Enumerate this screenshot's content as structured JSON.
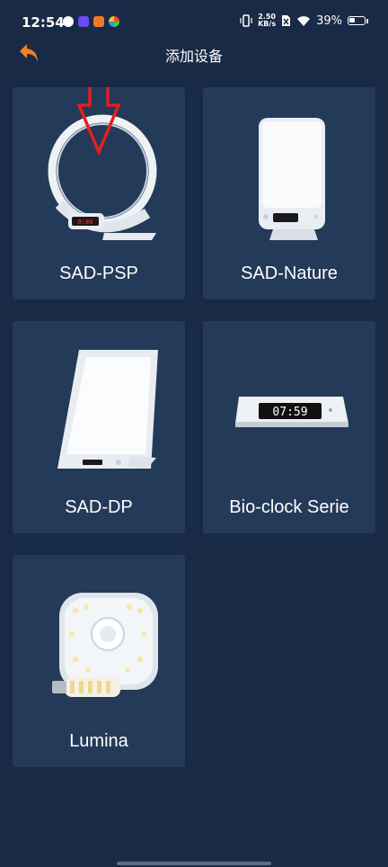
{
  "status_bar": {
    "time": "12:54",
    "net_speed_value": "2.50",
    "net_speed_unit": "KB/s",
    "battery": "39%"
  },
  "header": {
    "title": "添加设备"
  },
  "devices": [
    {
      "label": "SAD-PSP"
    },
    {
      "label": "SAD-Nature"
    },
    {
      "label": "SAD-DP"
    },
    {
      "label": "Bio-clock Serie"
    },
    {
      "label": "Lumina"
    }
  ],
  "colors": {
    "background": "#182a45",
    "card": "#233a59",
    "accent_back": "#f5821f",
    "arrow_annotation": "#e02020"
  },
  "icons": {
    "back": "back-arrow-icon"
  }
}
